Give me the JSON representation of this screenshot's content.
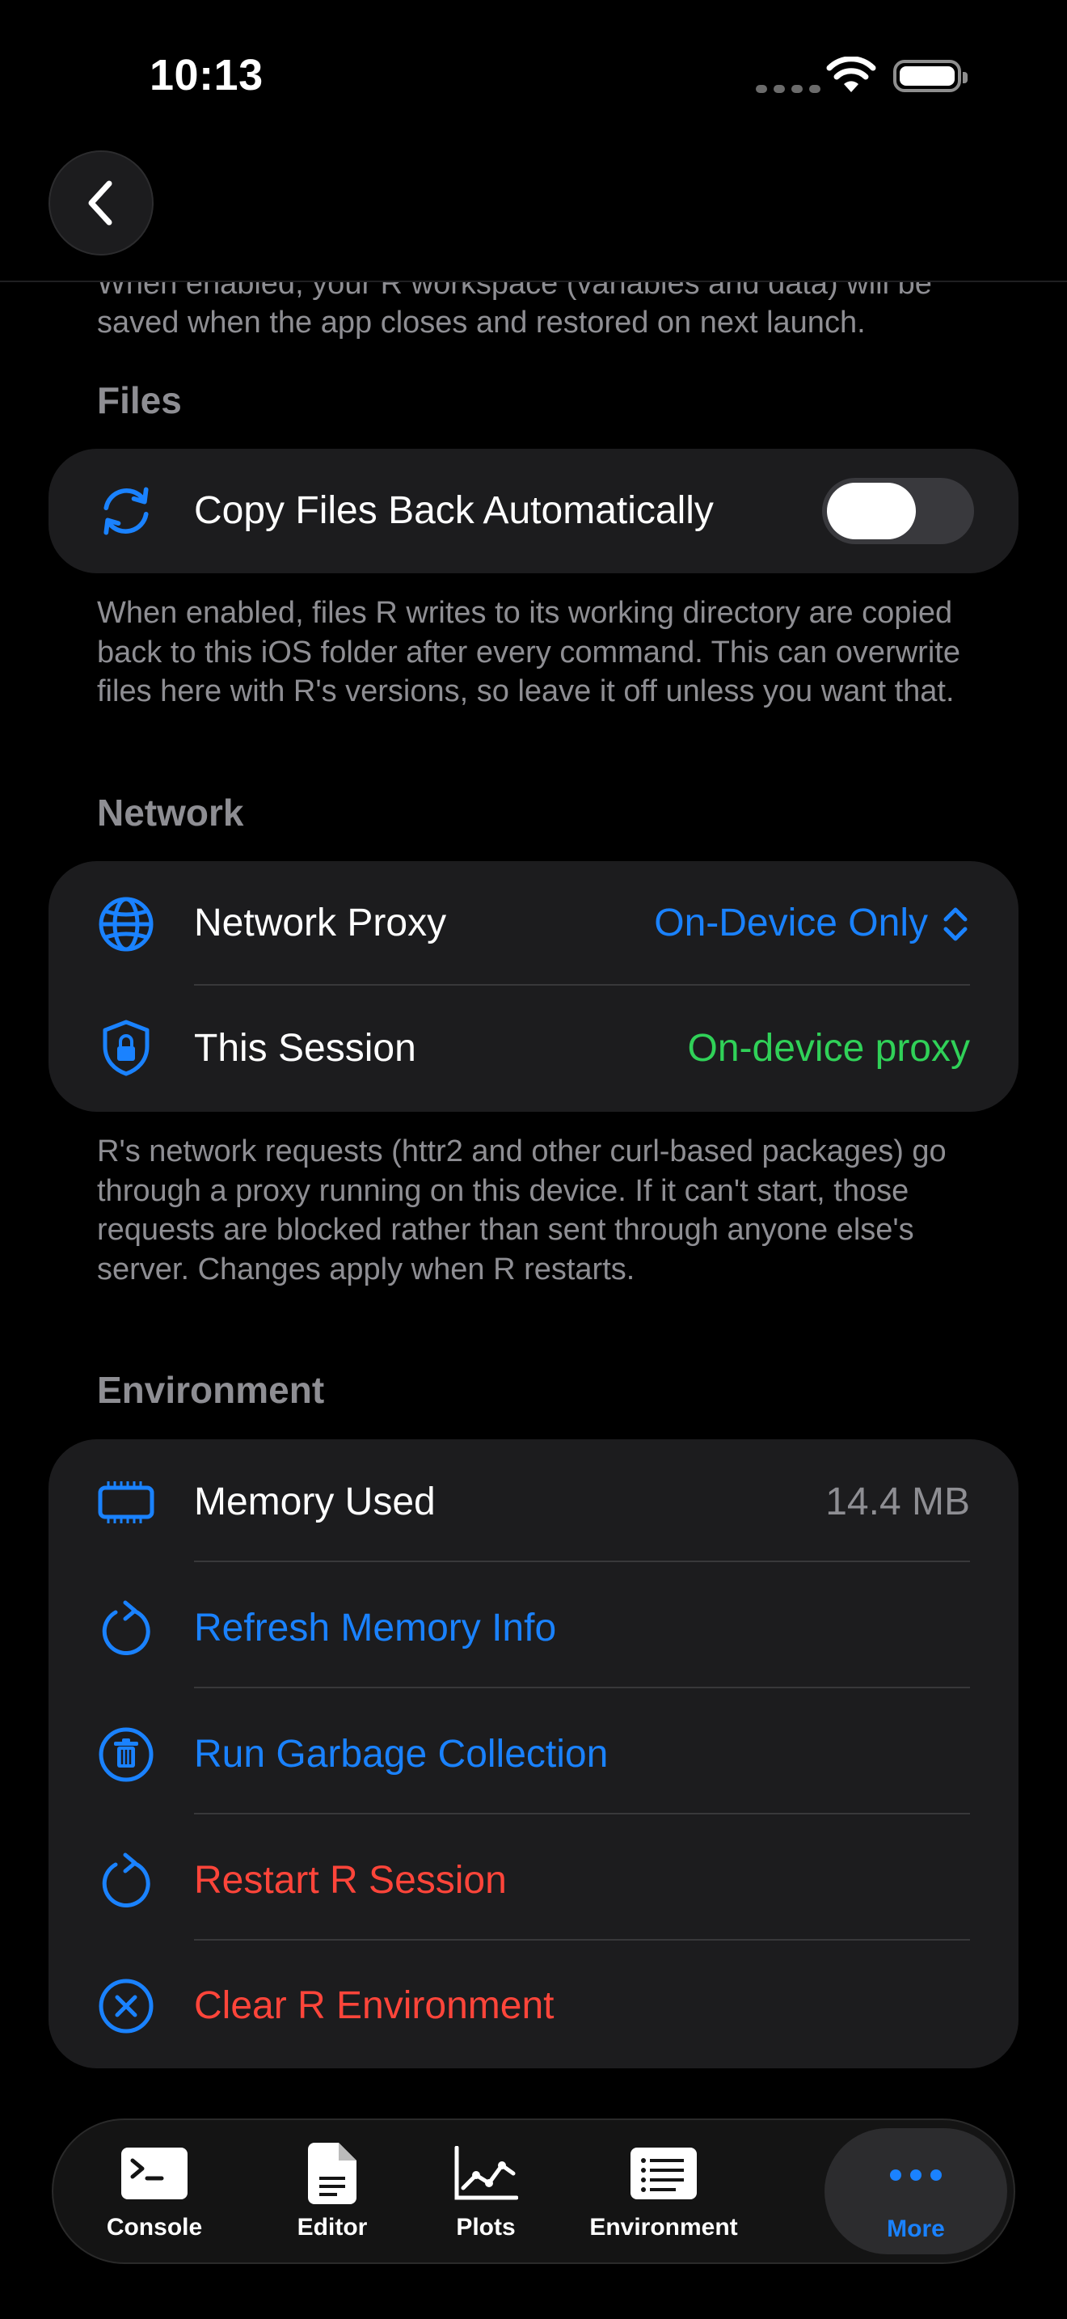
{
  "status_bar": {
    "time": "10:13"
  },
  "top_hint": "When enabled, your R workspace (variables and data) will be saved when the app closes and restored on next launch.",
  "files": {
    "title": "Files",
    "copy_back_label": "Copy Files Back Automatically",
    "copy_back_enabled": true,
    "footnote": "When enabled, files R writes to its working directory are copied back to this iOS folder after every command. This can overwrite files here with R's versions, so leave it off unless you want that."
  },
  "network": {
    "title": "Network",
    "proxy_label": "Network Proxy",
    "proxy_value": "On-Device Only",
    "session_label": "This Session",
    "session_value": "On-device proxy",
    "footnote": "R's network requests (httr2 and other curl-based packages) go through a proxy running on this device. If it can't start, those requests are blocked rather than sent through anyone else's server. Changes apply when R restarts."
  },
  "environment": {
    "title": "Environment",
    "memory_label": "Memory Used",
    "memory_value": "14.4 MB",
    "refresh_label": "Refresh Memory Info",
    "gc_label": "Run Garbage Collection",
    "restart_label": "Restart R Session",
    "clear_label": "Clear R Environment"
  },
  "tabbar": {
    "console": "Console",
    "editor": "Editor",
    "plots": "Plots",
    "environment": "Environment",
    "more": "More"
  },
  "colors": {
    "accent": "#1a82ff",
    "success": "#30d158",
    "destructive": "#ff453a"
  }
}
